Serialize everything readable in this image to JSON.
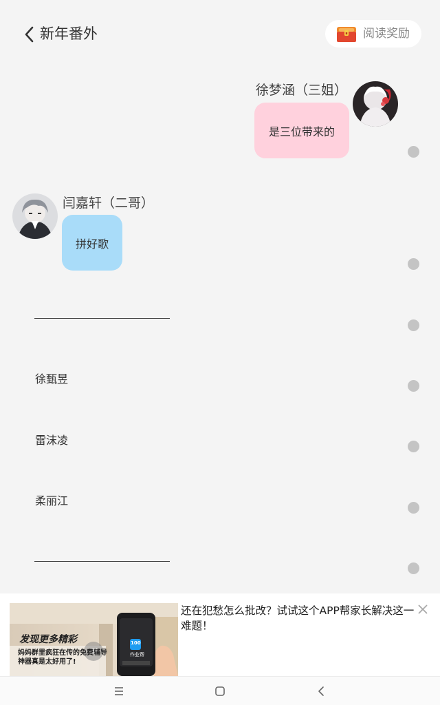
{
  "header": {
    "title": "新年番外",
    "reward_label": "阅读奖励"
  },
  "messages": [
    {
      "speaker": "徐梦涵（三姐）",
      "text": "是三位带来的",
      "side": "right",
      "bubble_color": "#ffd1dd"
    },
    {
      "speaker": "闫嘉轩（二哥）",
      "text": "拼好歌",
      "side": "left",
      "bubble_color": "#a9dcf9"
    }
  ],
  "name_options": [
    "徐甄昱",
    "雷沫凌",
    "柔丽江"
  ],
  "ad": {
    "image_title": "发现更多精彩",
    "image_caption": "妈妈群里疯狂在传的免费辅导神器真是太好用了!",
    "app_name": "作业帮",
    "app_badge": "100",
    "headline": "还在犯愁怎么批改？试试这个APP帮家长解决这一难题！"
  },
  "colors": {
    "background": "#f4f4f4",
    "pink_bubble": "#ffd1dd",
    "blue_bubble": "#a9dcf9",
    "dot": "#c4c4c4"
  },
  "icons": [
    "back-chevron-icon",
    "treasure-chest-icon",
    "close-icon",
    "menu-icon",
    "home-square-icon",
    "back-triangle-icon"
  ]
}
